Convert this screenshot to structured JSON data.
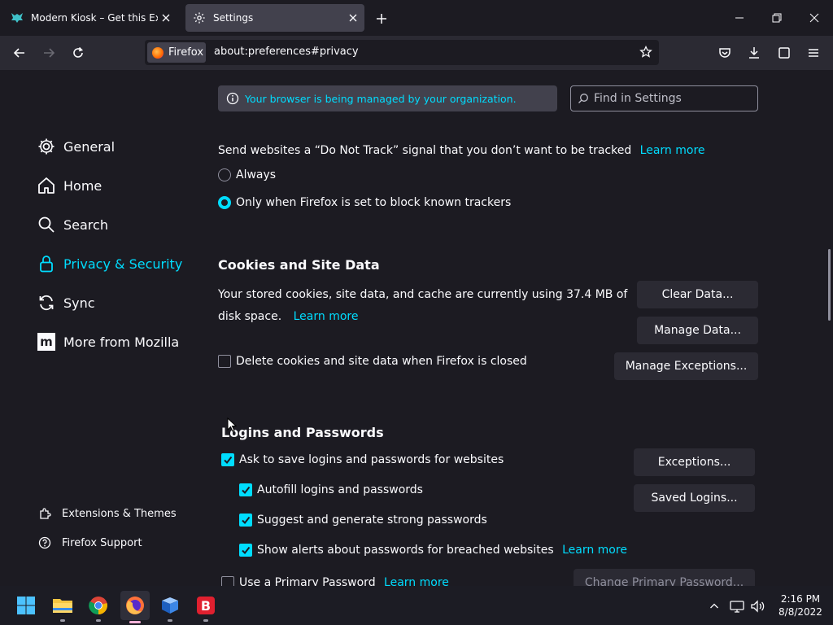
{
  "tabs": [
    {
      "title": "Modern Kiosk – Get this Extensio",
      "icon": "extension-fox-icon"
    },
    {
      "title": "Settings",
      "icon": "gear-icon"
    }
  ],
  "urlbar": {
    "identity_label": "Firefox",
    "url": "about:preferences#privacy"
  },
  "sidebar": {
    "items": [
      {
        "label": "General",
        "icon": "gear-icon"
      },
      {
        "label": "Home",
        "icon": "home-icon"
      },
      {
        "label": "Search",
        "icon": "search-icon"
      },
      {
        "label": "Privacy & Security",
        "icon": "lock-icon",
        "selected": true
      },
      {
        "label": "Sync",
        "icon": "sync-icon"
      },
      {
        "label": "More from Mozilla",
        "icon": "mozilla-icon"
      }
    ],
    "footer": [
      {
        "label": "Extensions & Themes",
        "icon": "puzzle-icon"
      },
      {
        "label": "Firefox Support",
        "icon": "help-icon"
      }
    ]
  },
  "managed_notice": "Your browser is being managed by your organization.",
  "find": {
    "placeholder": "Find in Settings"
  },
  "dnt": {
    "text": "Send websites a “Do Not Track” signal that you don’t want to be tracked",
    "learn_more": "Learn more",
    "options": [
      {
        "label": "Always",
        "selected": false
      },
      {
        "label": "Only when Firefox is set to block known trackers",
        "selected": true
      }
    ]
  },
  "cookies": {
    "heading": "Cookies and Site Data",
    "desc_line1": "Your stored cookies, site data, and cache are currently using 37.4 MB of",
    "desc_line2": "disk space.",
    "learn_more": "Learn more",
    "clear_button": "Clear Data...",
    "manage_button": "Manage Data...",
    "delete_on_close": {
      "label": "Delete cookies and site data when Firefox is closed",
      "checked": false
    },
    "exceptions_button": "Manage Exceptions..."
  },
  "logins": {
    "heading": "Logins and Passwords",
    "ask_to_save": {
      "label": "Ask to save logins and passwords for websites",
      "checked": true
    },
    "autofill": {
      "label": "Autofill logins and passwords",
      "checked": true
    },
    "suggest": {
      "label": "Suggest and generate strong passwords",
      "checked": true
    },
    "alerts": {
      "label": "Show alerts about passwords for breached websites",
      "checked": true
    },
    "alerts_learn_more": "Learn more",
    "primary_password": {
      "label": "Use a Primary Password",
      "checked": false
    },
    "primary_learn_more": "Learn more",
    "exceptions_button": "Exceptions...",
    "saved_logins_button": "Saved Logins...",
    "change_primary_button": "Change Primary Password..."
  },
  "taskbar": {
    "apps": [
      "start-icon",
      "file-explorer-icon",
      "chrome-icon",
      "firefox-icon",
      "app-icon",
      "bitwarden-icon"
    ],
    "time": "2:16 PM",
    "date": "8/8/2022"
  },
  "colors": {
    "accent": "#00ddff",
    "background": "#1c1b22",
    "toolbar": "#2b2a33"
  }
}
